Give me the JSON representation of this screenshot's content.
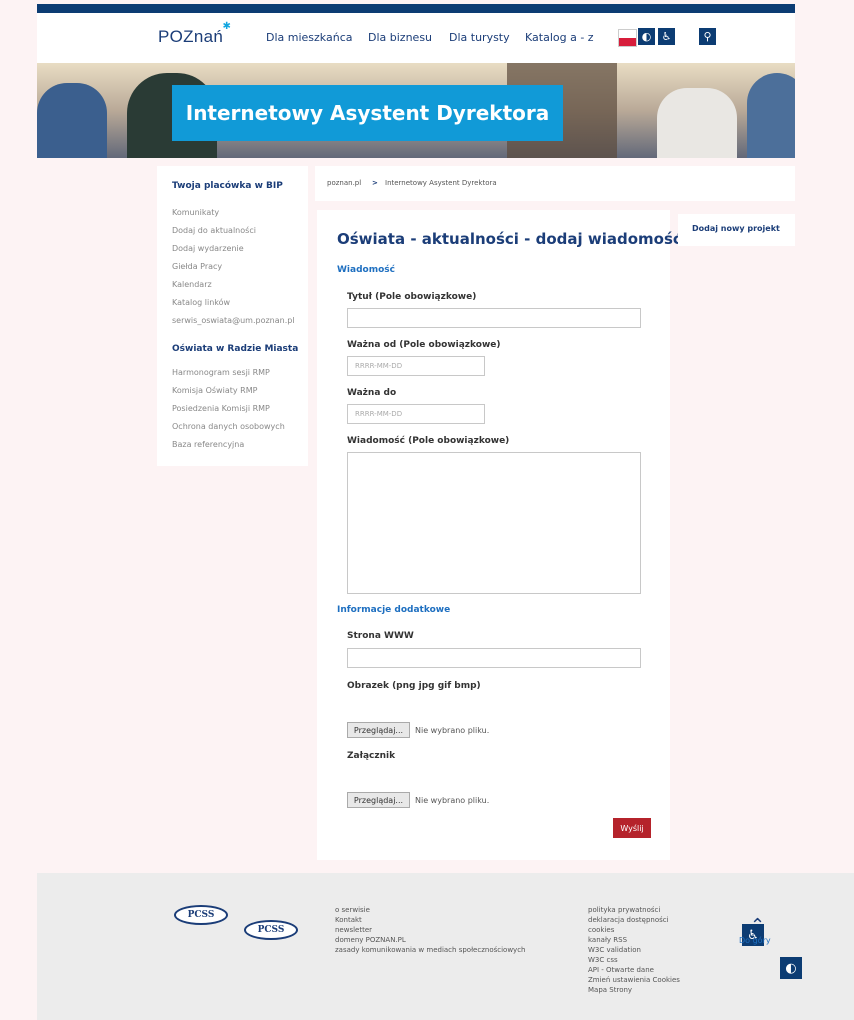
{
  "header": {
    "logo": "POZnań",
    "nav": [
      "Dla mieszkańca",
      "Dla biznesu",
      "Dla turysty",
      "Katalog a - z"
    ],
    "contrast_icon": "contrast-icon",
    "accessibility_icon": "wheelchair-icon",
    "search_icon": "search-icon"
  },
  "hero": {
    "title": "Internetowy Asystent Dyrektora"
  },
  "sidebar": {
    "section1_title": "Twoja placówka w BIP",
    "section1_items": [
      "Komunikaty",
      "Dodaj do aktualności",
      "Dodaj wydarzenie",
      "Giełda Pracy",
      "Kalendarz",
      "Katalog linków",
      "serwis_oswiata@um.poznan.pl"
    ],
    "section2_title": "Oświata w Radzie Miasta",
    "section2_items": [
      "Harmonogram sesji RMP",
      "Komisja Oświaty RMP",
      "Posiedzenia Komisji RMP",
      "Ochrona danych osobowych",
      "Baza referencyjna"
    ]
  },
  "breadcrumb": {
    "home": "poznan.pl",
    "sep": ">",
    "current": "Internetowy Asystent Dyrektora"
  },
  "form": {
    "title": "Oświata - aktualności - dodaj wiadomość",
    "section_message": "Wiadomość",
    "title_label": "Tytuł (Pole obowiązkowe)",
    "valid_from_label": "Ważna od (Pole obowiązkowe)",
    "valid_from_placeholder": "RRRR-MM-DD",
    "valid_to_label": "Ważna do",
    "valid_to_placeholder": "RRRR-MM-DD",
    "message_label": "Wiadomość (Pole obowiązkowe)",
    "section_extra": "Informacje dodatkowe",
    "www_label": "Strona WWW",
    "image_label": "Obrazek (png jpg gif bmp)",
    "attachment_label": "Załącznik",
    "browse_label": "Przeglądaj...",
    "no_file": "Nie wybrano pliku.",
    "submit_label": "Wyślij"
  },
  "right_panel": {
    "link": "Dodaj nowy projekt"
  },
  "footer": {
    "col1": [
      "o serwisie",
      "Kontakt",
      "newsletter",
      "domeny POZNAN.PL",
      "zasady komunikowania w mediach społecznościowych"
    ],
    "col2": [
      "polityka prywatności",
      "deklaracja dostępności",
      "cookies",
      "kanały RSS",
      "W3C validation",
      "W3C css",
      "API - Otwarte dane",
      "Zmień ustawienia Cookies",
      "Mapa Strony"
    ],
    "pcss": "PCSS",
    "to_top": "Do góry"
  }
}
